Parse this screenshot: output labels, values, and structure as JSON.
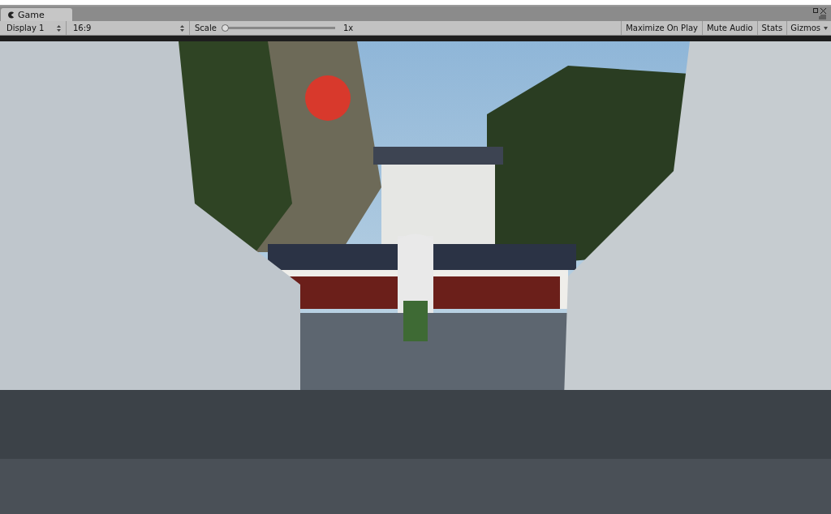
{
  "tab": {
    "title": "Game",
    "selected": true
  },
  "toolbar": {
    "display": "Display 1",
    "aspect": "16:9",
    "scale_label": "Scale",
    "scale": {
      "level": 0
    },
    "scale_reading": "1x",
    "toggles": [
      {
        "label": "Maximize On Play",
        "on": false
      },
      {
        "label": "Mute Audio",
        "on": false
      },
      {
        "label": "Stats",
        "on": false
      }
    ],
    "gizmos": "Gizmos"
  }
}
